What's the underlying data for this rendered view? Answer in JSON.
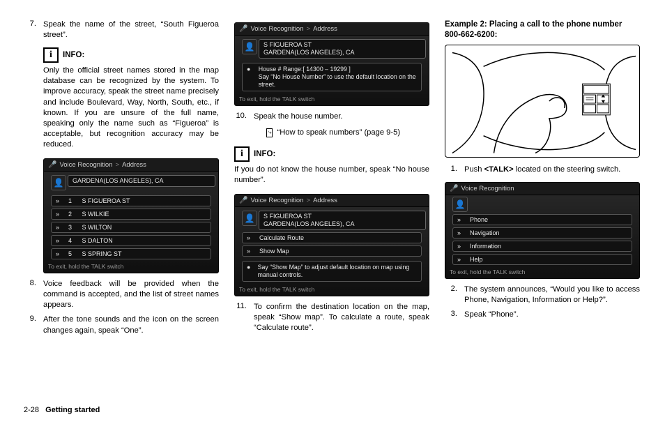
{
  "footer": {
    "page": "2-28",
    "section": "Getting started"
  },
  "col1": {
    "step7": {
      "n": "7.",
      "text": "Speak the name of the street, “South Figueroa street”."
    },
    "info_label": "INFO:",
    "info_text": "Only the official street names stored in the map database can be recognized by the system. To improve accuracy, speak the street name precisely and include Boulevard, Way, North, South, etc., if known. If you are unsure of the full name, speaking only the name such as “Figueroa” is acceptable, but recognition accuracy may be reduced.",
    "shot": {
      "title_a": "Voice Recognition",
      "title_b": "Address",
      "city": "GARDENA(LOS ANGELES), CA",
      "rows": [
        {
          "k": "1",
          "v": "S FIGUEROA ST"
        },
        {
          "k": "2",
          "v": "S WILKIE"
        },
        {
          "k": "3",
          "v": "S WILTON"
        },
        {
          "k": "4",
          "v": "S DALTON"
        },
        {
          "k": "5",
          "v": "S SPRING ST"
        }
      ],
      "foot": "To exit, hold the TALK switch"
    },
    "step8": {
      "n": "8.",
      "text": "Voice feedback will be provided when the command is accepted, and the list of street names appears."
    },
    "step9": {
      "n": "9.",
      "text": "After the tone sounds and the icon on the screen changes again, speak “One”."
    }
  },
  "col2": {
    "shotA": {
      "title_a": "Voice Recognition",
      "title_b": "Address",
      "line1": "S FIGUEROA ST",
      "line2": "GARDENA(LOS ANGELES), CA",
      "msg": "House # Range:[ 14300 – 19299 ]\nSay “No House Number” to use the default location on the street.",
      "foot": "To exit, hold the TALK switch"
    },
    "step10": {
      "n": "10.",
      "text": "Speak the house number."
    },
    "xref": "“How to speak numbers” (page 9-5)",
    "info_label": "INFO:",
    "info_text": "If you do not know the house number, speak “No house number”.",
    "shotB": {
      "title_a": "Voice Recognition",
      "title_b": "Address",
      "line1": "S FIGUEROA ST",
      "line2": "GARDENA(LOS ANGELES), CA",
      "opt1": "Calculate Route",
      "opt2": "Show Map",
      "msg": "Say “Show Map” to adjust default location on map using manual controls.",
      "foot": "To exit, hold the TALK switch"
    },
    "step11": {
      "n": "11.",
      "text": "To confirm the destination location on the map, speak “Show map”. To calculate a route, speak “Calculate route”."
    }
  },
  "col3": {
    "heading": "Example 2: Placing a call to the phone number 800-662-6200:",
    "step1": {
      "n": "1.",
      "pre": "Push ",
      "talk": "<TALK>",
      "post": " located on the steering switch."
    },
    "shot": {
      "title_a": "Voice Recognition",
      "rows": [
        "Phone",
        "Navigation",
        "Information",
        "Help"
      ],
      "foot": "To exit, hold the TALK switch"
    },
    "step2": {
      "n": "2.",
      "text": "The system announces, “Would you like to access Phone, Navigation, Information or Help?”."
    },
    "step3": {
      "n": "3.",
      "text": "Speak “Phone”."
    }
  }
}
